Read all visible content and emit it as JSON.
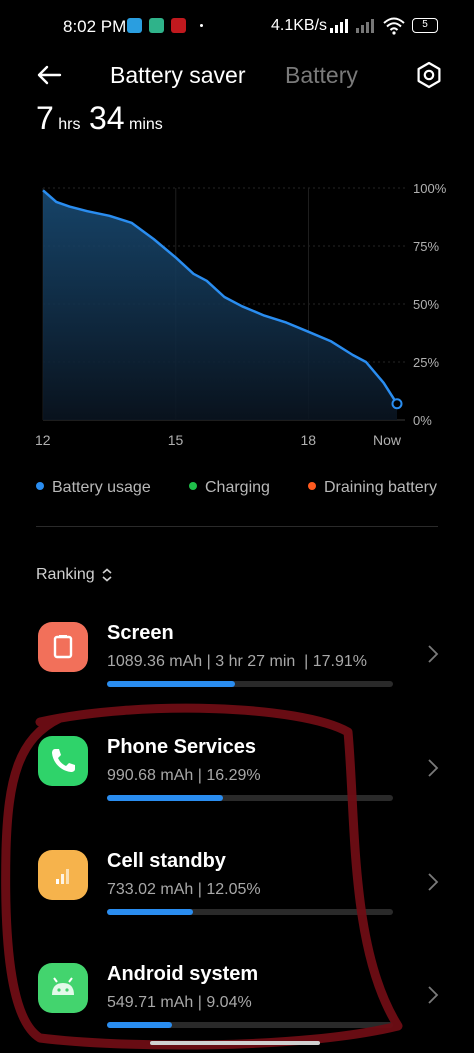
{
  "status_bar": {
    "time": "8:02 PM",
    "net_speed": "4.1KB/s",
    "battery_level": "5"
  },
  "header": {
    "title": "Battery saver",
    "tab_inactive": "Battery"
  },
  "remaining": {
    "hours": "7",
    "hours_unit": "hrs",
    "minutes": "34",
    "minutes_unit": "mins"
  },
  "chart_data": {
    "type": "area",
    "x_ticks": [
      "12",
      "15",
      "18",
      "Now"
    ],
    "y_ticks": [
      "100%",
      "75%",
      "50%",
      "25%",
      "0%"
    ],
    "ylim": [
      0,
      100
    ],
    "grid": true,
    "series": [
      {
        "name": "Battery usage",
        "color": "#2a8df0",
        "x": [
          12.0,
          12.3,
          12.6,
          13.0,
          13.5,
          14.0,
          14.5,
          15.0,
          15.4,
          15.7,
          16.1,
          16.5,
          17.0,
          17.5,
          18.0,
          18.5,
          19.0,
          19.3,
          19.7,
          20.0
        ],
        "y": [
          99,
          94,
          92,
          90,
          88,
          85,
          78,
          70,
          63,
          60,
          53,
          49,
          45,
          42,
          38,
          34,
          28,
          25,
          16,
          7
        ]
      }
    ]
  },
  "legend": {
    "usage": "Battery usage",
    "charging": "Charging",
    "draining": "Draining battery",
    "usage_color": "#2a8df0",
    "charging_color": "#1fbf4a",
    "draining_color": "#ff5a1f"
  },
  "ranking": {
    "label": "Ranking",
    "items": [
      {
        "name": "Screen",
        "stats": "1089.36 mAh | 3 hr 27 min  | 17.91%",
        "percent": 17.91,
        "icon": "screen-icon",
        "color": "#f2705a"
      },
      {
        "name": "Phone Services",
        "stats": "990.68 mAh | 16.29%",
        "percent": 16.29,
        "icon": "phone-icon",
        "color": "#2fd36a"
      },
      {
        "name": "Cell standby",
        "stats": "733.02 mAh | 12.05%",
        "percent": 12.05,
        "icon": "cell-signal-icon",
        "color": "#f6b34c"
      },
      {
        "name": "Android system",
        "stats": "549.71 mAh | 9.04%",
        "percent": 9.04,
        "icon": "android-icon",
        "color": "#43d46e"
      }
    ]
  }
}
